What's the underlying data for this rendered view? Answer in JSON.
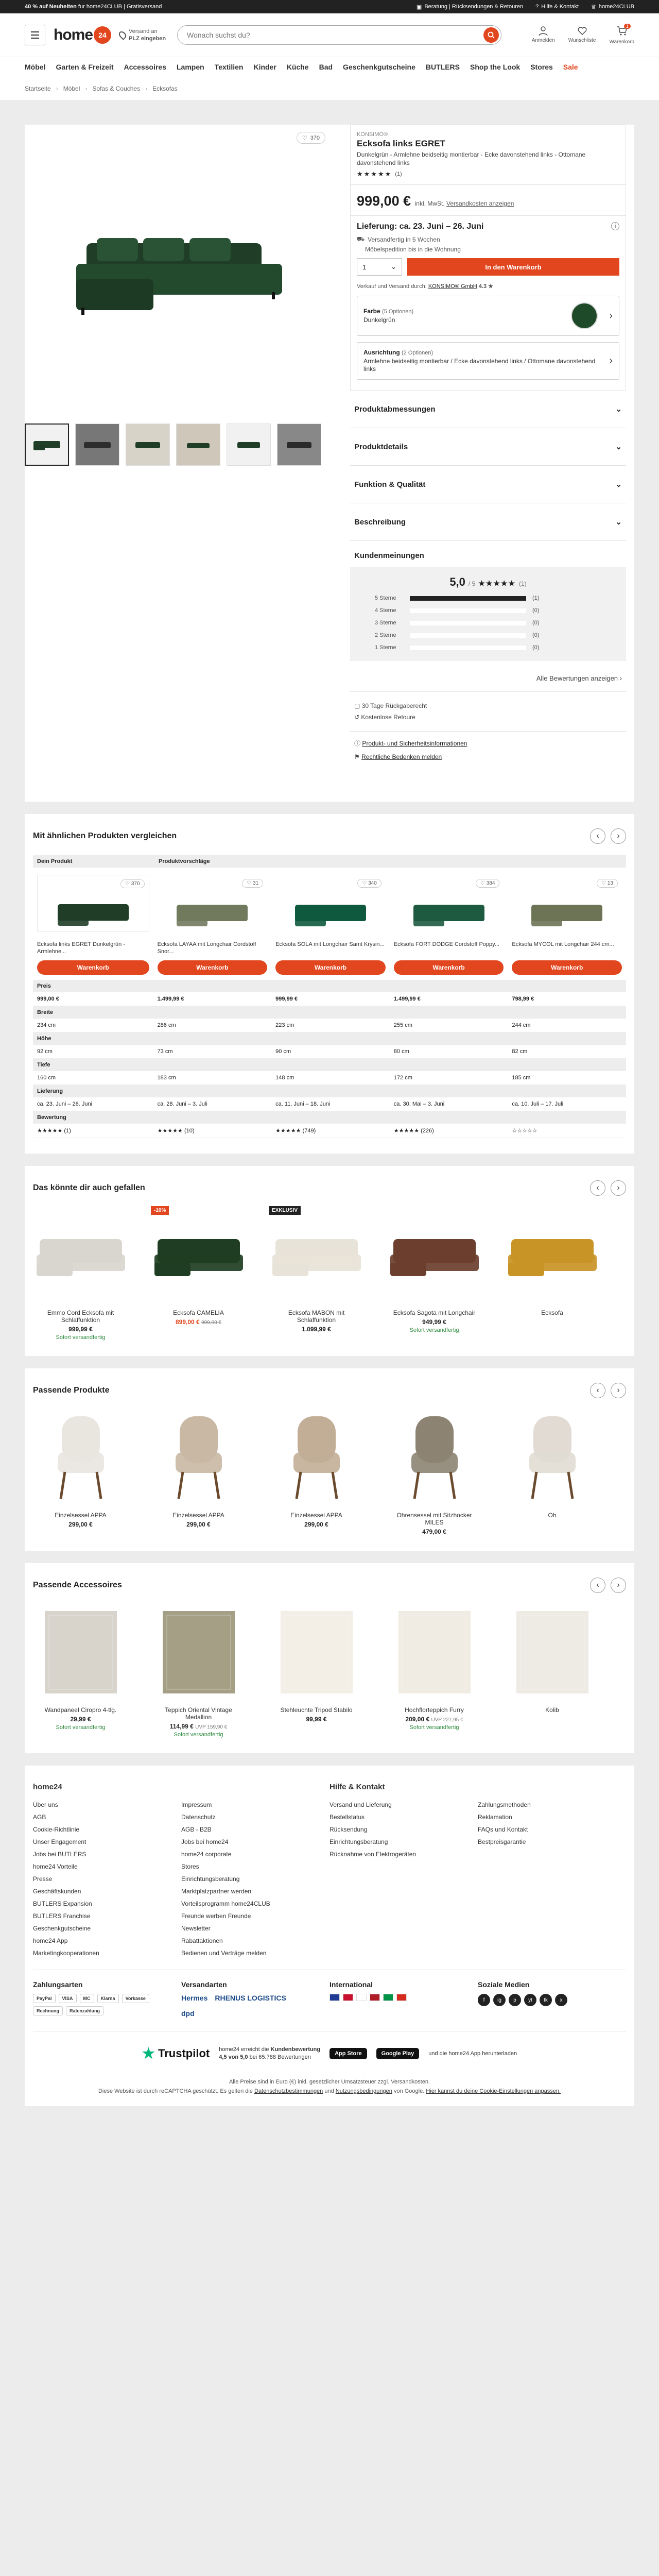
{
  "topbar": {
    "promo": "40 % auf Neuheiten",
    "promo_rest": "fur home24CLUB | Gratisversand",
    "returns": "Beratung | Rücksendungen & Retouren",
    "help": "Hilfe & Kontakt",
    "club": "home24CLUB"
  },
  "header": {
    "logo_text": "home",
    "logo_badge": "24",
    "delivery_line1": "Versand an",
    "delivery_line2": "PLZ eingeben",
    "search_placeholder": "Wonach suchst du?",
    "account": "Anmelden",
    "wishlist": "Wunschliste",
    "cart": "Warenkorb",
    "cart_count": "1"
  },
  "nav": [
    "Möbel",
    "Garten & Freizeit",
    "Accessoires",
    "Lampen",
    "Textilien",
    "Kinder",
    "Küche",
    "Bad",
    "Geschenkgutscheine",
    "BUTLERS",
    "Shop the Look",
    "Stores",
    "Sale"
  ],
  "breadcrumb": [
    "Startseite",
    "Möbel",
    "Sofas & Couches",
    "Ecksofas"
  ],
  "product": {
    "brand": "KONSIMO®",
    "title": "Ecksofa links EGRET",
    "desc": "Dunkelgrün - Armlehne beidseitig montierbar - Ecke davonstehend links - Ottomane davonstehend links",
    "rating_stars": "★★★★★",
    "rating_count": "(1)",
    "likes": "370",
    "price": "999,00 €",
    "price_note": "inkl. MwSt.",
    "shipping_link": "Versandkosten anzeigen",
    "delivery_title": "Lieferung: ca. 23. Juni – 26. Juni",
    "delivery_line1": "Versandfertig in 5 Wochen",
    "delivery_line2": "Möbelspedition bis in die Wohnung",
    "qty": "1",
    "cart_btn": "In den Warenkorb",
    "sold_by": "Verkauf und Versand durch:",
    "seller": "KONSIMO® GmbH",
    "seller_rating": "4.3 ★",
    "color_label": "Farbe",
    "color_options": "(5 Optionen)",
    "color_value": "Dunkelgrün",
    "swatch_color": "#1f4a2a",
    "align_label": "Ausrichtung",
    "align_options": "(2 Optionen)",
    "align_value": "Armlehne beidseitig montierbar / Ecke davonstehend links / Ottomane davonstehend links"
  },
  "accordion": [
    "Produktabmessungen",
    "Produktdetails",
    "Funktion & Qualität",
    "Beschreibung"
  ],
  "reviews": {
    "heading": "Kundenmeinungen",
    "average": "5,0",
    "of": "/ 5",
    "stars": "★★★★★",
    "count": "(1)",
    "bars": [
      {
        "label": "5 Sterne",
        "count": "(1)",
        "fraction": 1
      },
      {
        "label": "4 Sterne",
        "count": "(0)",
        "fraction": 0
      },
      {
        "label": "3 Sterne",
        "count": "(0)",
        "fraction": 0
      },
      {
        "label": "2 Sterne",
        "count": "(0)",
        "fraction": 0
      },
      {
        "label": "1 Sterne",
        "count": "(0)",
        "fraction": 0
      }
    ],
    "all_link": "Alle Bewertungen anzeigen"
  },
  "service": {
    "return_days": "30 Tage Rückgaberecht",
    "free_return": "Kostenlose Retoure",
    "safety": "Produkt- und Sicherheitsinformationen",
    "legal": "Rechtliche Bedenken melden"
  },
  "compare": {
    "heading": "Mit ähnlichen Produkten vergleichen",
    "your_product": "Dein Produkt",
    "suggestions": "Produktvorschläge",
    "button": "Warenkorb",
    "products": [
      {
        "name": "Ecksofa links EGRET Dunkelgrün - Armlehne...",
        "likes": "370",
        "color": "#1f3d27",
        "price": "999,00 €",
        "width": "234 cm",
        "height": "92 cm",
        "depth": "160 cm",
        "delivery": "ca. 23. Juni – 26. Juni",
        "stars": "★★★★★",
        "rcount": "(1)"
      },
      {
        "name": "Ecksofa LAYAA mit Longchair Cordstoff Snor...",
        "likes": "31",
        "color": "#727a5e",
        "price": "1.499,99 €",
        "width": "286 cm",
        "height": "73 cm",
        "depth": "183 cm",
        "delivery": "ca. 28. Juni – 3. Juli",
        "stars": "★★★★★",
        "rcount": "(10)"
      },
      {
        "name": "Ecksofa SOLA mit Longchair Samt Krysin...",
        "likes": "340",
        "color": "#0f5a3f",
        "price": "999,99 €",
        "width": "223 cm",
        "height": "90 cm",
        "depth": "148 cm",
        "delivery": "ca. 11. Juni – 18. Juni",
        "stars": "★★★★★",
        "rcount": "(749)"
      },
      {
        "name": "Ecksofa FORT DODGE Cordstoff Poppy...",
        "likes": "384",
        "color": "#1d5a40",
        "price": "1.499,99 €",
        "width": "255 cm",
        "height": "80 cm",
        "depth": "172 cm",
        "delivery": "ca. 30. Mai – 3. Juni",
        "stars": "★★★★★",
        "rcount": "(226)"
      },
      {
        "name": "Ecksofa MYCOL mit Longchair 244 cm...",
        "likes": "13",
        "color": "#6d7355",
        "price": "798,99 €",
        "width": "244 cm",
        "height": "82 cm",
        "depth": "185 cm",
        "delivery": "ca. 10. Juli – 17. Juli",
        "stars": "☆☆☆☆☆",
        "rcount": ""
      }
    ],
    "rows": [
      "Preis",
      "Breite",
      "Höhe",
      "Tiefe",
      "Lieferung",
      "Bewertung"
    ]
  },
  "also_like": {
    "heading": "Das könnte dir auch gefallen",
    "items": [
      {
        "name": "Emmo Cord Ecksofa mit Schlaffunktion",
        "price": "999,99 €",
        "old": "",
        "avail": "Sofort versandfertig",
        "color": "#d9d6cf",
        "badge": "",
        "badge_color": ""
      },
      {
        "name": "Ecksofa CAMELIA",
        "price": "899,00 €",
        "old": "999,00 €",
        "avail": "",
        "color": "#1e3d22",
        "badge": "-10%",
        "badge_color": "#e2461e"
      },
      {
        "name": "Ecksofa MABON mit Schlaffunktion",
        "price": "1.099,99 €",
        "old": "",
        "avail": "",
        "color": "#e8e3d8",
        "badge": "EXKLUSIV",
        "badge_color": "#222"
      },
      {
        "name": "Ecksofa Sagota mit Longchair",
        "price": "949,99 €",
        "old": "",
        "avail": "Sofort versandfertig",
        "color": "#6b3e2e",
        "badge": "",
        "badge_color": ""
      },
      {
        "name": "Ecksofa",
        "price": "",
        "old": "",
        "avail": "",
        "color": "#c99426",
        "badge": "",
        "badge_color": ""
      }
    ]
  },
  "matching": {
    "heading": "Passende Produkte",
    "items": [
      {
        "name": "Einzelsessel APPA",
        "price": "299,00 €",
        "color": "#e9e6e0"
      },
      {
        "name": "Einzelsessel APPA",
        "price": "299,00 €",
        "color": "#c9b8a3"
      },
      {
        "name": "Einzelsessel APPA",
        "price": "299,00 €",
        "color": "#c2ae96"
      },
      {
        "name": "Ohrensessel mit Sitzhocker MILES",
        "price": "479,00 €",
        "color": "#8c8372"
      },
      {
        "name": "Oh",
        "price": "",
        "color": "#e1dbd3"
      }
    ]
  },
  "accessories": {
    "heading": "Passende Accessoires",
    "items": [
      {
        "name": "Wandpaneel Ciropro 4-tlg.",
        "price": "29,99 €",
        "uvp": "",
        "avail": "Sofort versandfertig",
        "color": "#d8d4cc"
      },
      {
        "name": "Teppich Oriental Vintage Medallion",
        "price": "114,99 €",
        "uvp": "UVP 159,90 €",
        "avail": "Sofort versandfertig",
        "color": "#a59f86"
      },
      {
        "name": "Stehleuchte Tripod Stabilo",
        "price": "99,99 €",
        "uvp": "",
        "avail": "",
        "color": "#f3eee6"
      },
      {
        "name": "Hochflorteppich Furry",
        "price": "209,00 €",
        "uvp": "UVP 227,95 €",
        "avail": "Sofort versandfertig",
        "color": "#f0ebe3"
      },
      {
        "name": "Kolib",
        "price": "",
        "uvp": "",
        "avail": "",
        "color": "#eeeae4"
      }
    ]
  },
  "footer": {
    "col1_title": "home24",
    "col1": [
      "Über uns",
      "AGB",
      "Cookie-Richtlinie",
      "Unser Engagement",
      "Jobs bei BUTLERS",
      "home24 Vorteile",
      "Presse",
      "Geschäftskunden",
      "BUTLERS Expansion",
      "BUTLERS Franchise",
      "Geschenkgutscheine",
      "home24 App",
      "Marketingkooperationen"
    ],
    "col2": [
      "Impressum",
      "Datenschutz",
      "AGB - B2B",
      "Jobs bei home24",
      "home24 corporate",
      "Stores",
      "Einrichtungsberatung",
      "Marktplatzpartner werden",
      "Vorteilsprogramm home24CLUB",
      "Freunde werben Freunde",
      "Newsletter",
      "Rabattaktionen",
      "Bedienen und Verträge melden"
    ],
    "col3_title": "Hilfe & Kontakt",
    "col3": [
      "Versand und Lieferung",
      "Bestellstatus",
      "Rücksendung",
      "Einrichtungsberatung",
      "Rücknahme von Elektrogeräten"
    ],
    "col4": [
      "Zahlungsmethoden",
      "Reklamation",
      "FAQs und Kontakt",
      "Bestpreisgarantie"
    ],
    "pay_title": "Zahlungsarten",
    "pay": [
      "PayPal",
      "VISA",
      "MC",
      "Klarna",
      "Vorkasse",
      "Rechnung",
      "Ratenzahlung"
    ],
    "ship_title": "Versandarten",
    "ship": [
      "Hermes",
      "RHENUS LOGISTICS",
      "dpd"
    ],
    "intl_title": "International",
    "flags": [
      "#1f3a93",
      "#c8102e",
      "#ffffff",
      "#ae1c28",
      "#009246",
      "#d52b1e"
    ],
    "social_title": "Soziale Medien",
    "social": [
      "f",
      "ig",
      "p",
      "yt",
      "tk",
      "x"
    ],
    "trust_name": "Trustpilot",
    "trust_line1": "home24 erreicht die",
    "trust_bold": "Kundenbewertung",
    "trust_score": "4,5 von 5,0",
    "trust_line2": "bei 65.788 Bewertungen",
    "appstore": "App Store",
    "googleplay": "Google Play",
    "app_text": "und die home24 App herunterladen",
    "legal1": "Alle Preise sind in Euro (€) inkl. gesetzlicher Umsatzsteuer zzgl. Versandkosten.",
    "legal2_a": "Diese Website ist durch reCAPTCHA geschützt. Es gelten die",
    "privacy": "Datenschutzbestimmungen",
    "legal2_b": "und",
    "terms": "Nutzungsbedingungen",
    "legal2_c": "von Google.",
    "cookie": "Hier kannst du deine Cookie-Einstellungen anpassen."
  }
}
